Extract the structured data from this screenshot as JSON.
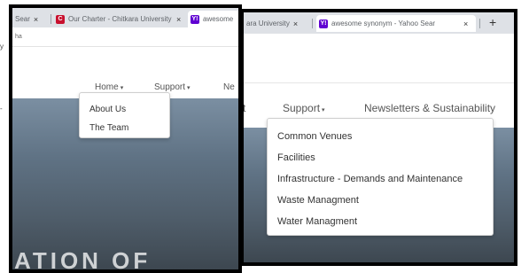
{
  "left": {
    "tabs": [
      {
        "title": "Sear",
        "favicon": "",
        "close": "×",
        "active": false
      },
      {
        "title": "Our Charter - Chitkara University",
        "favicon": "C",
        "close": "×",
        "active": false
      },
      {
        "title": "awesome",
        "favicon": "Y!",
        "close": "",
        "active": true
      }
    ],
    "address_text": "ha",
    "nav": {
      "home_label": "Home",
      "support_label": "Support",
      "ne_label": "Ne",
      "caret": "▾"
    },
    "dropdown": {
      "items": [
        "About Us",
        "The Team"
      ]
    },
    "hero_text": "ATION OF"
  },
  "right": {
    "tabs": [
      {
        "title": "ara University",
        "favicon": "",
        "close": "×",
        "active": false
      },
      {
        "title": "awesome synonym - Yahoo Sear",
        "favicon": "Y!",
        "close": "×",
        "active": true
      }
    ],
    "new_tab": "+",
    "nav": {
      "partial_label": "t",
      "support_label": "Support",
      "newsletters_label": "Newsletters & Sustainability",
      "caret": "▾"
    },
    "dropdown": {
      "items": [
        "Common Venues",
        "Facilities",
        "Infrastructure - Demands and Maintenance",
        "Waste Managment",
        "Water Managment"
      ]
    }
  },
  "edge_labels": [
    "y",
    "-"
  ],
  "colors": {
    "chitkara_red": "#c8102e",
    "yahoo_purple": "#6001d2",
    "hero_blue": "#5f7284"
  }
}
